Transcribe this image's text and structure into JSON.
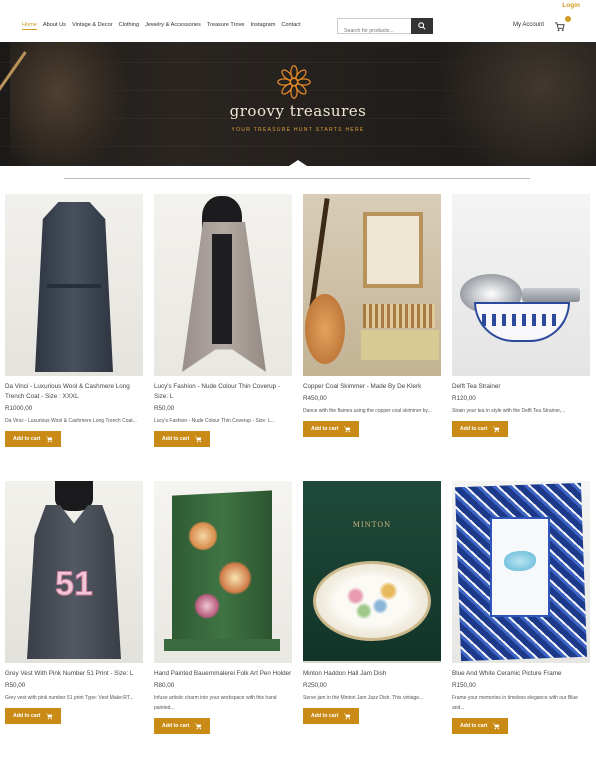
{
  "topbar": {
    "login_label": "Login"
  },
  "nav": {
    "links": [
      "Home",
      "About Us",
      "Vintage & Decor",
      "Clothing",
      "Jewelry & Accessories",
      "Treasure Trove",
      "Instagram",
      "Contact"
    ],
    "active_index": 0,
    "search_placeholder": "Search for products...",
    "account_label": "My Account",
    "accent_color": "#d19a22"
  },
  "hero": {
    "title": "groovy treasures",
    "subtitle": "YOUR TREASURE HUNT STARTS HERE"
  },
  "products": [
    {
      "name": "Da Vinci - Luxurious Wool & Cashmere Long Trench Coat - Size : XXXL",
      "price": "R1000,00",
      "desc": "Da Vinci - Luxurious Wool & Cashmere Long Trench Coat...",
      "button": "Add to cart"
    },
    {
      "name": "Lucy's Fashion - Nude Colour Thin Coverup - Size: L",
      "price": "R50,00",
      "desc": "Lucy's Fashion - Nude Colour Thin Coverup - Size: L...",
      "button": "Add to cart"
    },
    {
      "name": "Copper Coal Skimmer - Made By De Klerk",
      "price": "R450,00",
      "desc": "Dance with the flames using the copper coal skimmer by...",
      "button": "Add to cart"
    },
    {
      "name": "Delft Tea Strainer",
      "price": "R120,00",
      "desc": "Strain your tea in style with the Delft Tea Strainer,...",
      "button": "Add to cart"
    },
    {
      "name": "Grey Vest With Pink Number 51 Print - Size: L",
      "price": "R50,00",
      "desc": "Grey vest with pink number 51 print Type: Vest Make:RT...",
      "button": "Add to cart"
    },
    {
      "name": "Hand Painted Bauernmalerei Folk Art Pen Holder",
      "price": "R80,00",
      "desc": "Infuse artistic charm into your workspace with this hand painted...",
      "button": "Add to cart"
    },
    {
      "name": "Minton Haddon Hall Jam Dish",
      "price": "R250,00",
      "desc": "Serve jam in the Minton Jam Jazz Dish. This vintage...",
      "button": "Add to cart"
    },
    {
      "name": "Blue And White Ceramic Picture Frame",
      "price": "R150,00",
      "desc": "Frame your memories in timeless elegance with our Blue and...",
      "button": "Add to cart"
    }
  ],
  "image_labels": {
    "vest_number": "51",
    "dish_brand": "MINTON"
  }
}
